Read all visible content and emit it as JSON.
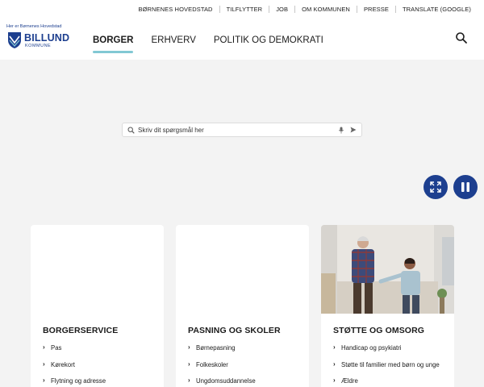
{
  "top_links": [
    "BØRNENES HOVEDSTAD",
    "TILFLYTTER",
    "JOB",
    "OM KOMMUNEN",
    "PRESSE",
    "TRANSLATE (GOOGLE)"
  ],
  "logo": {
    "tagline": "Her er Børnenes Hovedstad",
    "name": "BILLUND",
    "sub": "KOMMUNE"
  },
  "nav": [
    "BORGER",
    "ERHVERV",
    "POLITIK OG DEMOKRATI"
  ],
  "nav_active": "BORGER",
  "search": {
    "placeholder": "Skriv dit spørgsmål her"
  },
  "cards": [
    {
      "title": "BORGERSERVICE",
      "items": [
        "Pas",
        "Kørekort",
        "Flytning og adresse"
      ]
    },
    {
      "title": "PASNING OG SKOLER",
      "items": [
        "Børnepasning",
        "Folkeskoler",
        "Ungdomsuddannelse"
      ]
    },
    {
      "title": "STØTTE OG OMSORG",
      "items": [
        "Handicap og psykiatri",
        "Støtte til familier med børn og unge",
        "Ældre"
      ]
    }
  ],
  "colors": {
    "brand": "#1d3f8f",
    "accent_underline": "#82c8d4",
    "background": "#f3f3f3"
  },
  "icons": {
    "search": "search-icon",
    "mic": "microphone-icon",
    "send": "send-icon",
    "expand": "expand-icon",
    "pause": "pause-icon",
    "chevron": "chevron-right-icon"
  }
}
